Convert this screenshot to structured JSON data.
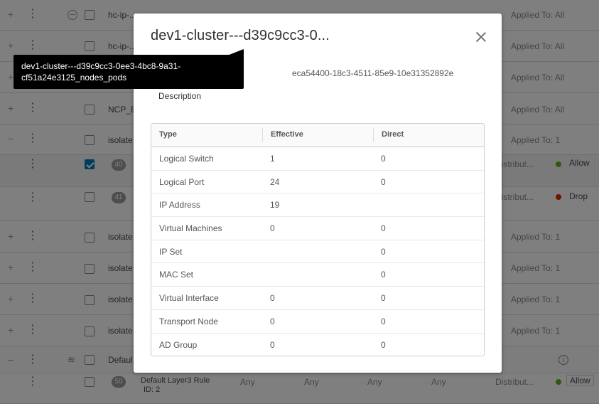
{
  "background": {
    "rows": [
      {
        "name": "hc-ip-...",
        "applied": "Applied To: All"
      },
      {
        "name": "hc-ip-...",
        "applied": "Applied To: All"
      },
      {
        "name": "",
        "applied": "Applied To: All"
      },
      {
        "name": "NCP_B...",
        "applied": "Applied To: All"
      },
      {
        "name": "isolate...",
        "applied": "Applied To: 1"
      },
      {
        "id": "40",
        "distrib": "Distribut...",
        "action": "Allow"
      },
      {
        "id": "41",
        "distrib": "Distribut...",
        "action": "Drop"
      },
      {
        "name": "isolate...",
        "applied": "Applied To: 1"
      },
      {
        "name": "isolate...",
        "applied": "Applied To: 1"
      },
      {
        "name": "isolate...",
        "applied": "Applied To: 1"
      },
      {
        "name": "isolate...",
        "applied": "Applied To: 1"
      },
      {
        "name": "Defaul..."
      },
      {
        "id": "50",
        "rule_name": "Default Layer3 Rule",
        "rule_id": "ID: 2",
        "any1": "Any",
        "any2": "Any",
        "any3": "Any",
        "any4": "Any",
        "distrib": "Distribut...",
        "action": "Allow"
      }
    ],
    "status_colors": {
      "allow": "#60b515",
      "drop": "#e62700"
    }
  },
  "modal": {
    "title": "dev1-cluster---d39c9cc3-0...",
    "id_value": "eca54400-18c3-4511-85e9-10e31352892e",
    "description_label": "Description",
    "table": {
      "headers": [
        "Type",
        "Effective",
        "Direct"
      ],
      "rows": [
        [
          "Logical Switch",
          "1",
          "0"
        ],
        [
          "Logical Port",
          "24",
          "0"
        ],
        [
          "IP Address",
          "19",
          ""
        ],
        [
          "Virtual Machines",
          "0",
          "0"
        ],
        [
          "IP Set",
          "",
          "0"
        ],
        [
          "MAC Set",
          "",
          "0"
        ],
        [
          "Virtual Interface",
          "0",
          "0"
        ],
        [
          "Transport Node",
          "0",
          "0"
        ],
        [
          "AD Group",
          "0",
          "0"
        ]
      ]
    }
  },
  "tooltip": {
    "line1": "dev1-cluster---d39c9cc3-0ee3-4bc8-9a31-",
    "line2": "cf51a24e3125_nodes_pods"
  }
}
